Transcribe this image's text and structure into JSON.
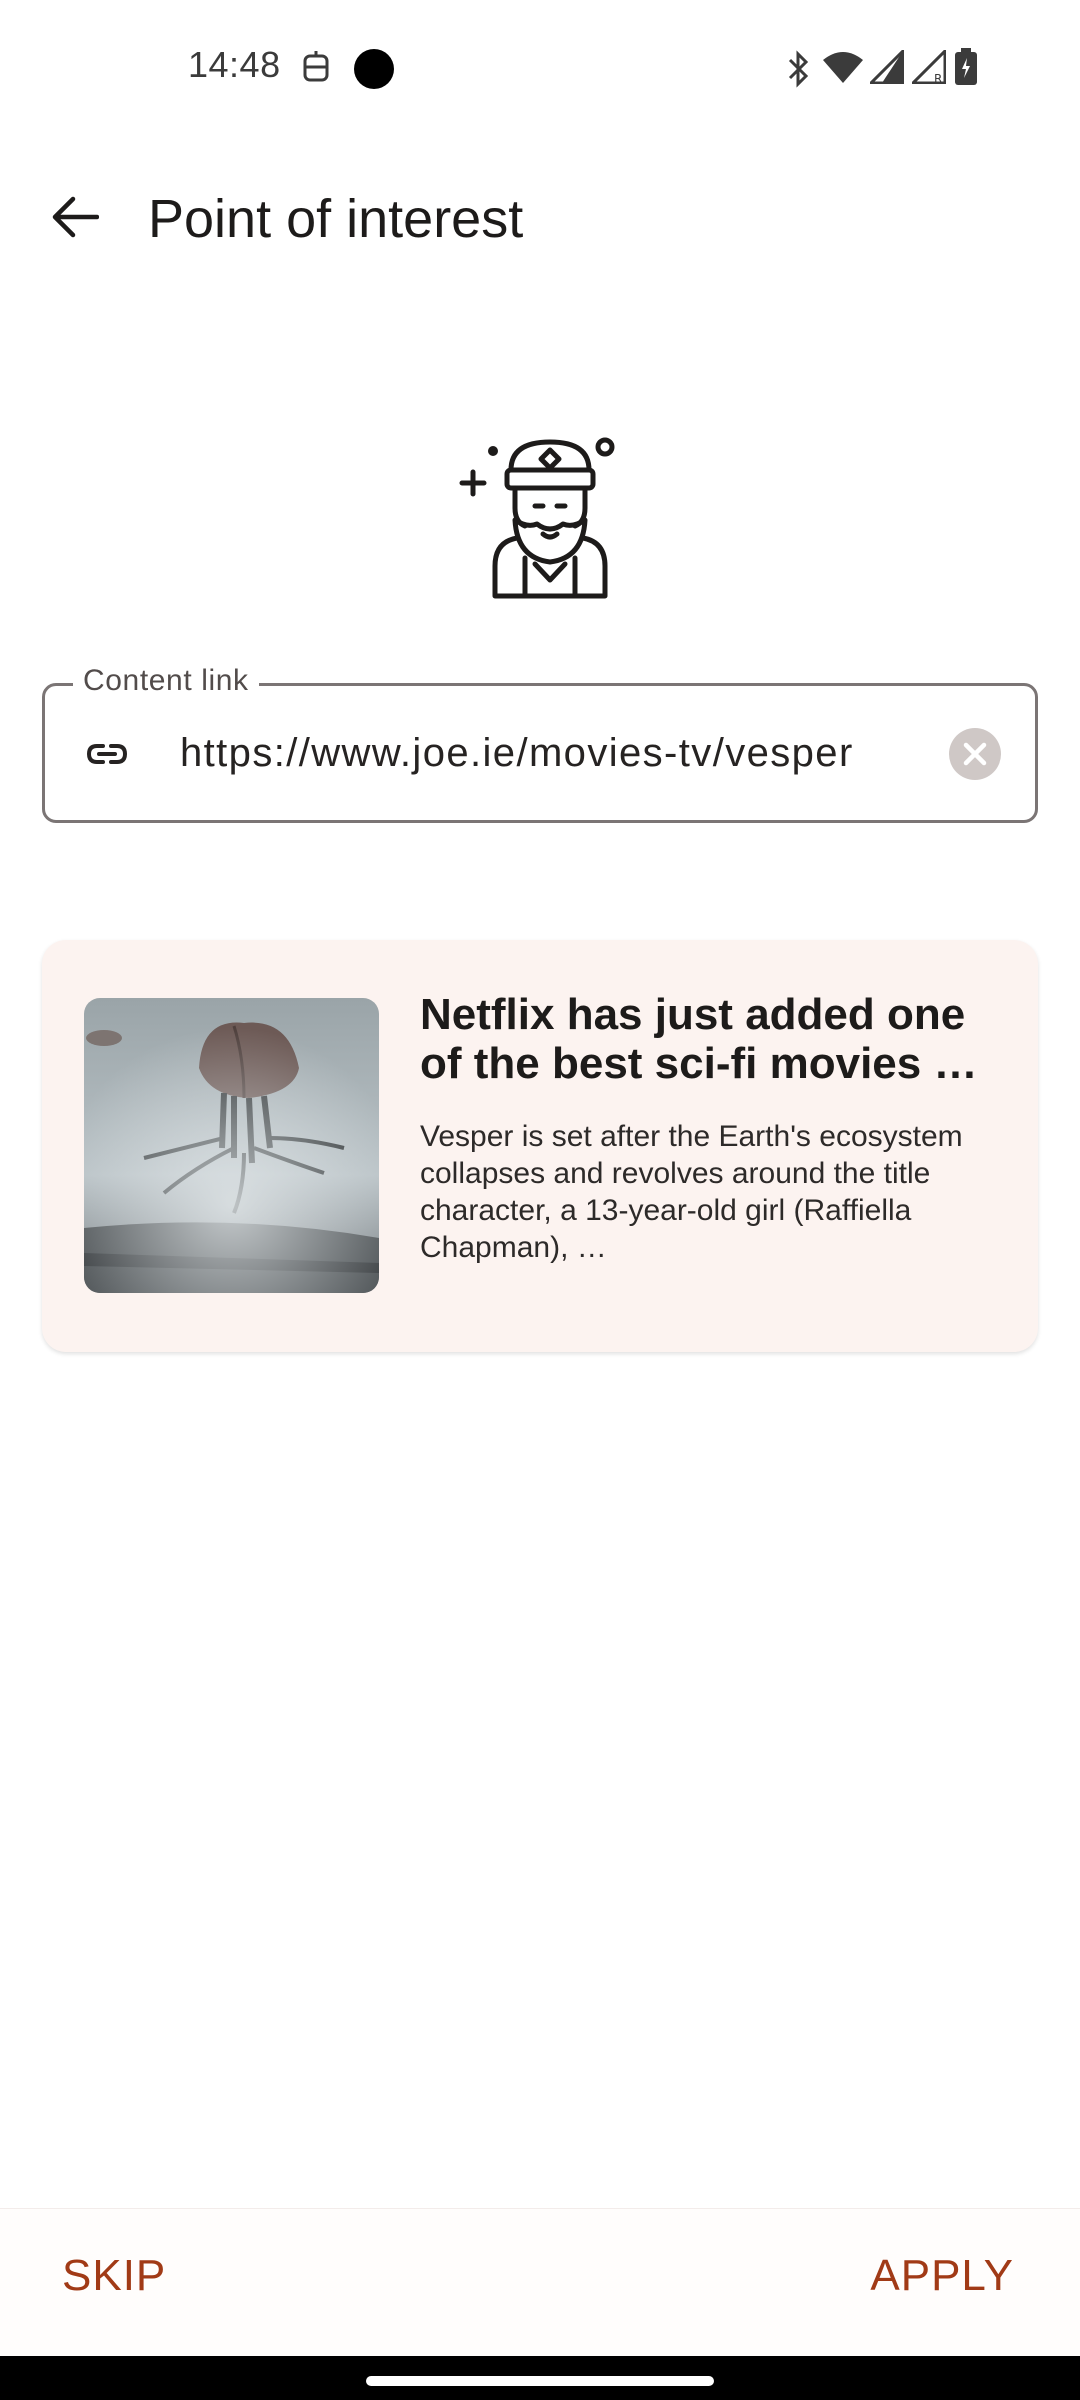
{
  "status_bar": {
    "time": "14:48"
  },
  "app_bar": {
    "title": "Point of interest",
    "back_icon": "arrow-back-icon"
  },
  "illustration": {
    "icon": "bearded-sage-icon"
  },
  "content_link_field": {
    "label": "Content link",
    "value": "https://www.joe.ie/movies-tv/vesper",
    "leading_icon": "link-icon",
    "trailing_icon": "clear-icon"
  },
  "preview": {
    "title": "Netflix has just added one of the best sci-fi movies …",
    "description": "Vesper is set after the Earth's ecosystem collapses and revolves around the title character, a 13-year-old girl (Raffiella Chapman), …",
    "image": "movie-still-thumbnail"
  },
  "actions": {
    "skip": "SKIP",
    "apply": "APPLY"
  },
  "colors": {
    "accent": "#a13a16",
    "card_background": "#fcf3f0",
    "outline": "#7b7575"
  }
}
